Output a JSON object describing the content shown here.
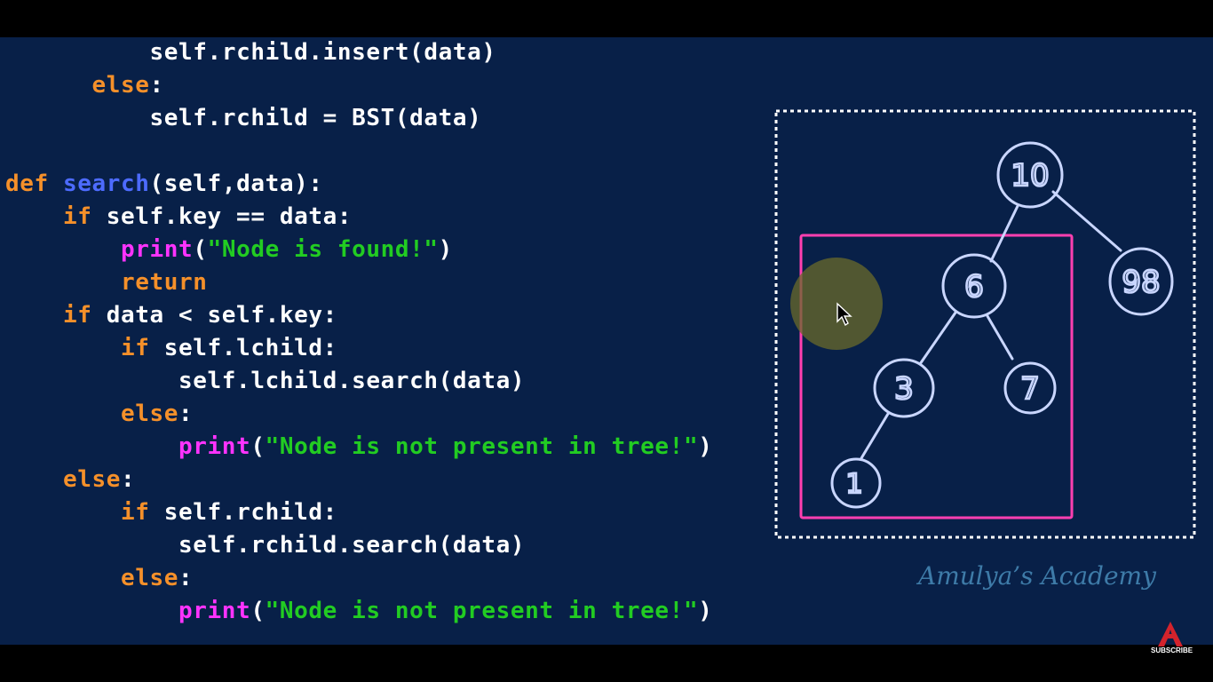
{
  "code_lines": [
    {
      "id": "l1",
      "indent": "          ",
      "tokens": [
        {
          "t": "self.rchild.insert(data)",
          "c": "tx"
        }
      ]
    },
    {
      "id": "l2",
      "indent": "      ",
      "tokens": [
        {
          "t": "else",
          "c": "kw"
        },
        {
          "t": ":",
          "c": "tx"
        }
      ]
    },
    {
      "id": "l3",
      "indent": "          ",
      "tokens": [
        {
          "t": "self.rchild = BST(data)",
          "c": "tx"
        }
      ]
    },
    {
      "id": "l4",
      "indent": "",
      "tokens": []
    },
    {
      "id": "l5",
      "indent": "",
      "tokens": [
        {
          "t": "def ",
          "c": "kw"
        },
        {
          "t": "search",
          "c": "fn"
        },
        {
          "t": "(self,data):",
          "c": "tx"
        }
      ]
    },
    {
      "id": "l6",
      "indent": "    ",
      "tokens": [
        {
          "t": "if ",
          "c": "kw"
        },
        {
          "t": "self.key == data:",
          "c": "tx"
        }
      ]
    },
    {
      "id": "l7",
      "indent": "        ",
      "tokens": [
        {
          "t": "print",
          "c": "pr"
        },
        {
          "t": "(",
          "c": "tx"
        },
        {
          "t": "\"Node is found!\"",
          "c": "st"
        },
        {
          "t": ")",
          "c": "tx"
        }
      ]
    },
    {
      "id": "l8",
      "indent": "        ",
      "tokens": [
        {
          "t": "return",
          "c": "kw"
        }
      ]
    },
    {
      "id": "l9",
      "indent": "    ",
      "tokens": [
        {
          "t": "if ",
          "c": "kw"
        },
        {
          "t": "data < self.key:",
          "c": "tx"
        }
      ]
    },
    {
      "id": "l10",
      "indent": "        ",
      "tokens": [
        {
          "t": "if ",
          "c": "kw"
        },
        {
          "t": "self.lchild:",
          "c": "tx"
        }
      ]
    },
    {
      "id": "l11",
      "indent": "            ",
      "tokens": [
        {
          "t": "self.lchild.search(data)",
          "c": "tx"
        }
      ]
    },
    {
      "id": "l12",
      "indent": "        ",
      "tokens": [
        {
          "t": "else",
          "c": "kw"
        },
        {
          "t": ":",
          "c": "tx"
        }
      ]
    },
    {
      "id": "l13",
      "indent": "            ",
      "tokens": [
        {
          "t": "print",
          "c": "pr"
        },
        {
          "t": "(",
          "c": "tx"
        },
        {
          "t": "\"Node is not present in tree!\"",
          "c": "st"
        },
        {
          "t": ")",
          "c": "tx"
        }
      ]
    },
    {
      "id": "l14",
      "indent": "    ",
      "tokens": [
        {
          "t": "else",
          "c": "kw"
        },
        {
          "t": ":",
          "c": "tx"
        }
      ]
    },
    {
      "id": "l15",
      "indent": "        ",
      "tokens": [
        {
          "t": "if ",
          "c": "kw"
        },
        {
          "t": "self.rchild:",
          "c": "tx"
        }
      ]
    },
    {
      "id": "l16",
      "indent": "            ",
      "tokens": [
        {
          "t": "self.rchild.search(data)",
          "c": "tx"
        }
      ]
    },
    {
      "id": "l17",
      "indent": "        ",
      "tokens": [
        {
          "t": "else",
          "c": "kw"
        },
        {
          "t": ":",
          "c": "tx"
        }
      ]
    },
    {
      "id": "l18",
      "indent": "            ",
      "tokens": [
        {
          "t": "print",
          "c": "pr"
        },
        {
          "t": "(",
          "c": "tx"
        },
        {
          "t": "\"Node is not present in tree!\"",
          "c": "st"
        },
        {
          "t": ")",
          "c": "tx"
        }
      ]
    }
  ],
  "tree": {
    "nodes": [
      {
        "id": "n10",
        "label": "10"
      },
      {
        "id": "n6",
        "label": "6"
      },
      {
        "id": "n98",
        "label": "98"
      },
      {
        "id": "n3",
        "label": "3"
      },
      {
        "id": "n7",
        "label": "7"
      },
      {
        "id": "n1",
        "label": "1"
      }
    ],
    "highlighted_subtree_root": "6"
  },
  "watermark": "Amulya’s Academy",
  "logo": {
    "letter": "A",
    "caption": "SUBSCRIBE"
  },
  "colors": {
    "background": "#082048",
    "keyword": "#f5902a",
    "function": "#4d6bff",
    "print": "#ff33ff",
    "string": "#22cc22",
    "tree_stroke": "#c9d6ff",
    "highlight_box": "#ff3fb0",
    "logo_red": "#d3232c"
  },
  "icons": {
    "cursor": "mouse-pointer-icon"
  }
}
